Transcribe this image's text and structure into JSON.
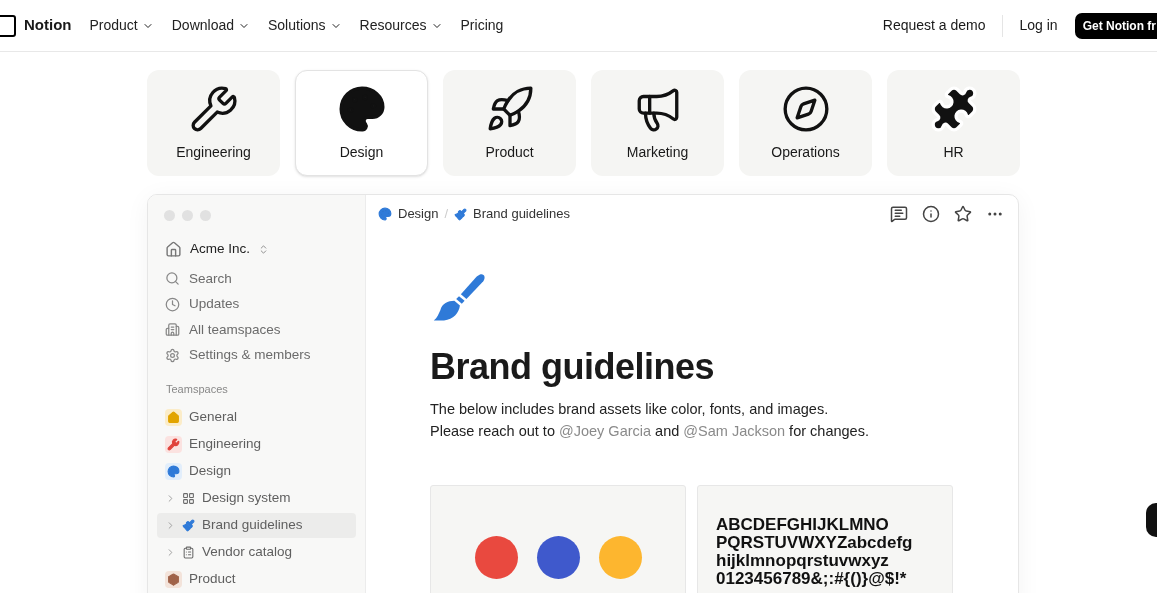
{
  "nav": {
    "brand": "Notion",
    "links": [
      {
        "label": "Product",
        "dropdown": true
      },
      {
        "label": "Download",
        "dropdown": true
      },
      {
        "label": "Solutions",
        "dropdown": true
      },
      {
        "label": "Resources",
        "dropdown": true
      },
      {
        "label": "Pricing",
        "dropdown": false
      }
    ],
    "actions": {
      "demo": "Request a demo",
      "login": "Log in",
      "cta": "Get Notion fr"
    }
  },
  "categories": [
    {
      "label": "Engineering",
      "selected": false
    },
    {
      "label": "Design",
      "selected": true
    },
    {
      "label": "Product",
      "selected": false
    },
    {
      "label": "Marketing",
      "selected": false
    },
    {
      "label": "Operations",
      "selected": false
    },
    {
      "label": "HR",
      "selected": false
    }
  ],
  "sidebar": {
    "workspace": "Acme Inc.",
    "items": [
      "Search",
      "Updates",
      "All teamspaces",
      "Settings & members"
    ],
    "section": "Teamspaces",
    "teamspaces": [
      {
        "label": "General",
        "kind": "teamspace",
        "color": "#fbecc8",
        "selected": false
      },
      {
        "label": "Engineering",
        "kind": "teamspace",
        "color": "#fbe2e0",
        "selected": false
      },
      {
        "label": "Design",
        "kind": "teamspace",
        "color": "#e2eefb",
        "selected": false
      },
      {
        "label": "Design system",
        "kind": "page",
        "selected": false
      },
      {
        "label": "Brand guidelines",
        "kind": "page",
        "selected": true
      },
      {
        "label": "Vendor catalog",
        "kind": "page",
        "selected": false
      },
      {
        "label": "Product",
        "kind": "teamspace",
        "color": "#f3e3da",
        "selected": false
      }
    ]
  },
  "breadcrumb": [
    "Design",
    "Brand guidelines"
  ],
  "breadcrumb_separator": "/",
  "page": {
    "title": "Brand guidelines",
    "description": [
      [
        {
          "kind": "text",
          "text": "The below includes brand assets like color, fonts, and images."
        }
      ],
      [
        {
          "kind": "text",
          "text": "Please reach out to "
        },
        {
          "kind": "mention",
          "text": "@Joey Garcia"
        },
        {
          "kind": "text",
          "text": " and "
        },
        {
          "kind": "mention",
          "text": "@Sam Jackson"
        },
        {
          "kind": "text",
          "text": " for changes."
        }
      ]
    ],
    "swatches": [
      {
        "color": "#e9493f"
      },
      {
        "color": "#3f59cc"
      },
      {
        "color": "#fdb62f"
      }
    ],
    "specimen": [
      "ABCDEFGHIJKLMNO",
      "PQRSTUVWXYZabcdefg",
      "hijklmnopqrstuvwxyz",
      "0123456789&;:#{()}@$!*"
    ]
  }
}
